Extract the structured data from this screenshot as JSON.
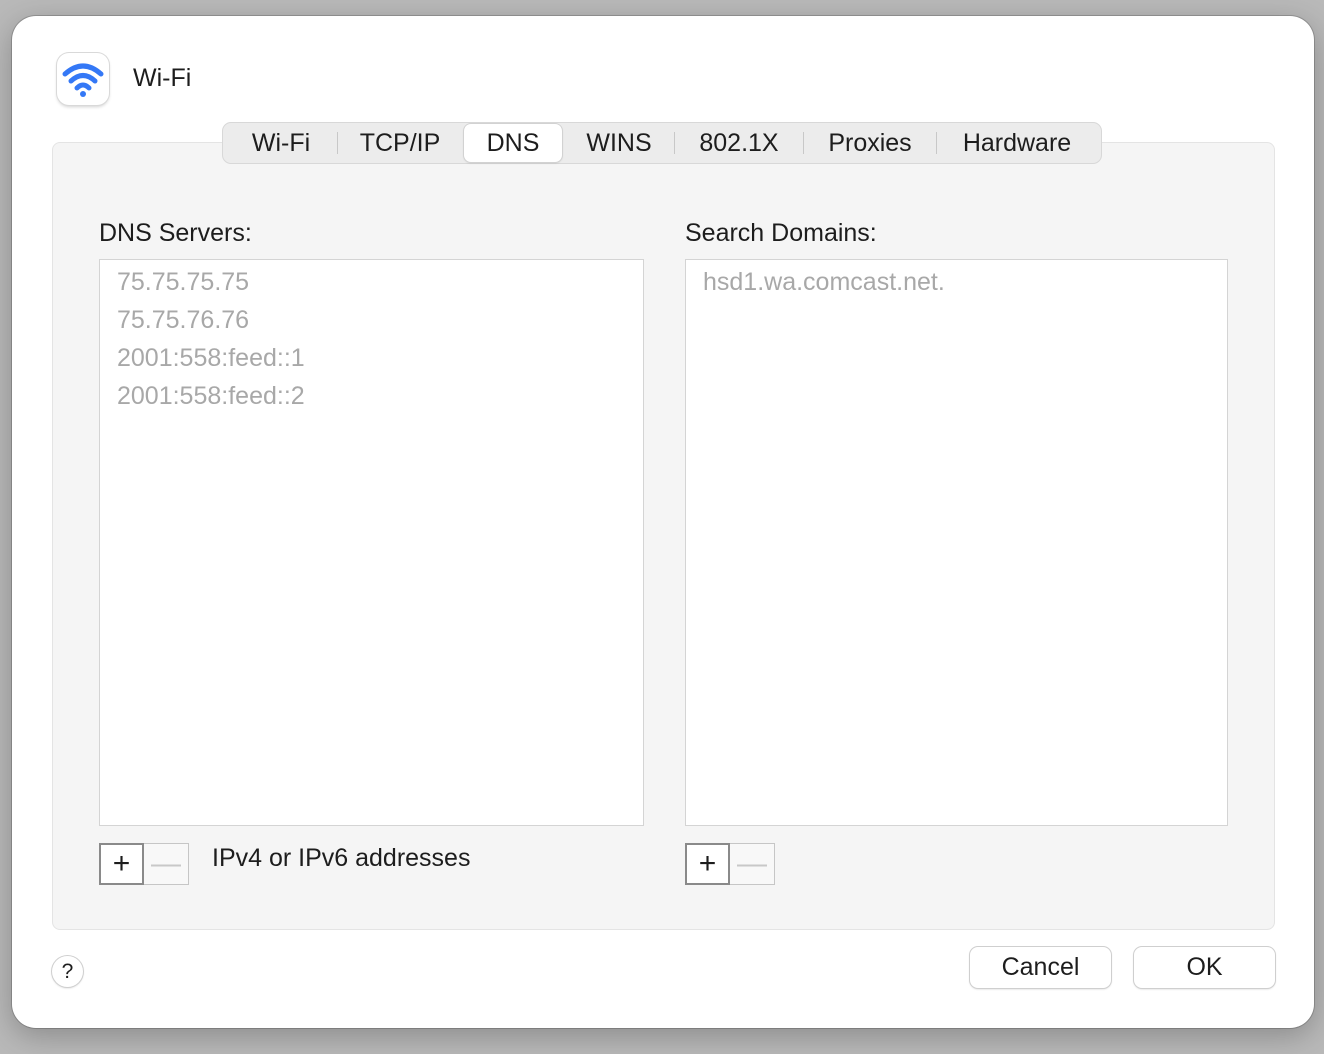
{
  "window": {
    "title": "Wi-Fi",
    "icon": "wifi-icon",
    "accent_color": "#3478f6"
  },
  "tabs": [
    {
      "label": "Wi-Fi",
      "active": false
    },
    {
      "label": "TCP/IP",
      "active": false
    },
    {
      "label": "DNS",
      "active": true
    },
    {
      "label": "WINS",
      "active": false
    },
    {
      "label": "802.1X",
      "active": false
    },
    {
      "label": "Proxies",
      "active": false
    },
    {
      "label": "Hardware",
      "active": false
    }
  ],
  "dns_servers": {
    "label": "DNS Servers:",
    "items": [
      "75.75.75.75",
      "75.75.76.76",
      "2001:558:feed::1",
      "2001:558:feed::2"
    ],
    "add_label": "+",
    "remove_label": "—",
    "hint": "IPv4 or IPv6 addresses"
  },
  "search_domains": {
    "label": "Search Domains:",
    "items": [
      "hsd1.wa.comcast.net."
    ],
    "add_label": "+",
    "remove_label": "—"
  },
  "footer": {
    "help_label": "?",
    "cancel_label": "Cancel",
    "ok_label": "OK"
  }
}
